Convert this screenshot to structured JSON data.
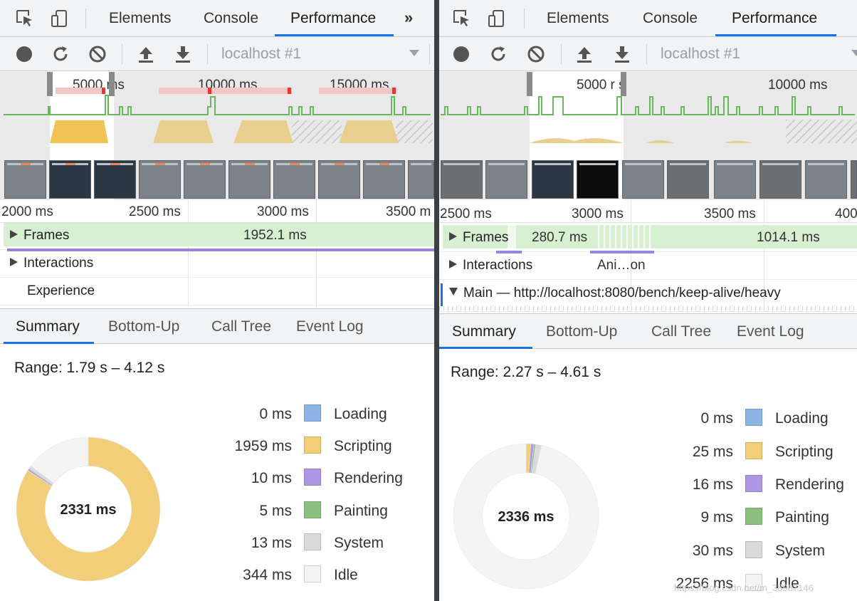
{
  "left": {
    "tabs": [
      "Elements",
      "Console",
      "Performance"
    ],
    "active_tab": "Performance",
    "overflow": "»",
    "profile": "localhost #1",
    "overview_ticks": [
      "5000 ms",
      "10000 ms",
      "15000 ms"
    ],
    "ruler": [
      "2000 ms",
      "2500 ms",
      "3000 ms",
      "3500 m"
    ],
    "tracks": {
      "frames": "Frames",
      "frames_value": "1952.1 ms",
      "interactions": "Interactions",
      "experience": "Experience"
    },
    "bottom_tabs": [
      "Summary",
      "Bottom-Up",
      "Call Tree",
      "Event Log"
    ],
    "range": "Range: 1.79 s – 4.12 s",
    "total": "2331 ms",
    "legend": [
      {
        "ms": "0 ms",
        "name": "Loading",
        "color": "#8cb4e5",
        "value": 0
      },
      {
        "ms": "1959 ms",
        "name": "Scripting",
        "color": "#f2ce79",
        "value": 1959
      },
      {
        "ms": "10 ms",
        "name": "Rendering",
        "color": "#af97e6",
        "value": 10
      },
      {
        "ms": "5 ms",
        "name": "Painting",
        "color": "#8cc07f",
        "value": 5
      },
      {
        "ms": "13 ms",
        "name": "System",
        "color": "#dadada",
        "value": 13
      },
      {
        "ms": "344 ms",
        "name": "Idle",
        "color": "#f4f4f4",
        "value": 344
      }
    ]
  },
  "right": {
    "tabs": [
      "Elements",
      "Console",
      "Performance"
    ],
    "active_tab": "Performance",
    "profile": "localhost #1",
    "overview_ticks": [
      "5000 r s",
      "10000 ms"
    ],
    "ruler": [
      "2500 ms",
      "3000 ms",
      "3500 ms",
      "400"
    ],
    "tracks": {
      "frames": "Frames",
      "frames_value_1": "280.7 ms",
      "frames_value_2": "1014.1 ms",
      "interactions": "Interactions",
      "animation": "Ani…on",
      "main": "Main — http://localhost:8080/bench/keep-alive/heavy"
    },
    "bottom_tabs": [
      "Summary",
      "Bottom-Up",
      "Call Tree",
      "Event Log"
    ],
    "range": "Range: 2.27 s – 4.61 s",
    "total": "2336 ms",
    "legend": [
      {
        "ms": "0 ms",
        "name": "Loading",
        "color": "#8cb4e5",
        "value": 0
      },
      {
        "ms": "25 ms",
        "name": "Scripting",
        "color": "#f2ce79",
        "value": 25
      },
      {
        "ms": "16 ms",
        "name": "Rendering",
        "color": "#af97e6",
        "value": 16
      },
      {
        "ms": "9 ms",
        "name": "Painting",
        "color": "#8cc07f",
        "value": 9
      },
      {
        "ms": "30 ms",
        "name": "System",
        "color": "#dadada",
        "value": 30
      },
      {
        "ms": "2256 ms",
        "name": "Idle",
        "color": "#f4f4f4",
        "value": 2256
      }
    ],
    "watermark": "https://blog.csdn.net/m_38987146"
  }
}
